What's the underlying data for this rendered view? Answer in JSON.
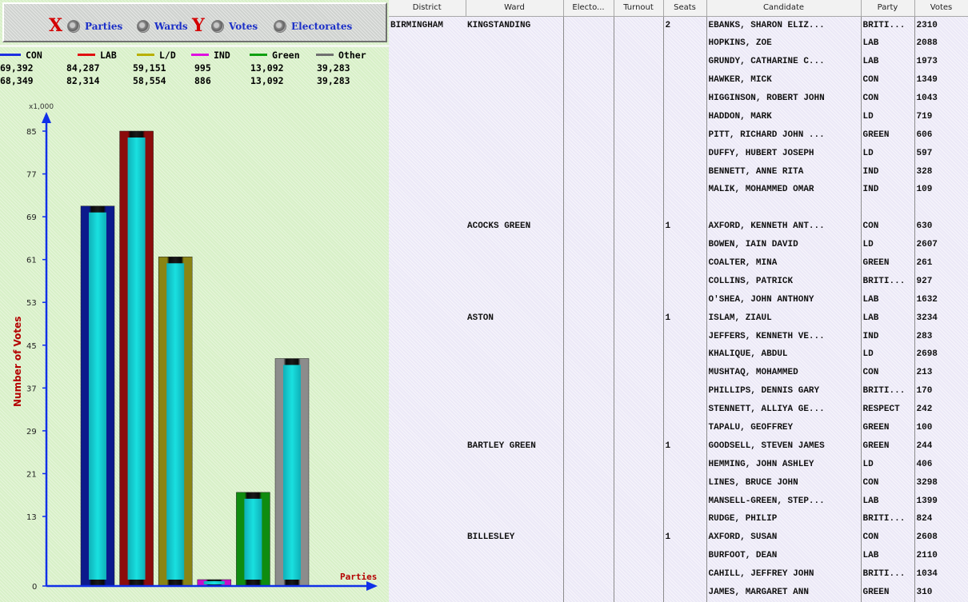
{
  "toolbar": {
    "x_axis_letter": "X",
    "y_axis_letter": "Y",
    "options": [
      {
        "label": "Parties"
      },
      {
        "label": "Wards"
      },
      {
        "label": "Votes"
      },
      {
        "label": "Electorates"
      }
    ]
  },
  "legend": {
    "series": [
      {
        "name": "CON",
        "color": "#1c2ee0",
        "votes": "69,392",
        "electorates": "68,349"
      },
      {
        "name": "LAB",
        "color": "#e01010",
        "votes": "84,287",
        "electorates": "82,314"
      },
      {
        "name": "L/D",
        "color": "#b8b000",
        "votes": "59,151",
        "electorates": "58,554"
      },
      {
        "name": "IND",
        "color": "#e010e0",
        "votes": "995",
        "electorates": "886"
      },
      {
        "name": "Green",
        "color": "#10a010",
        "votes": "13,092",
        "electorates": "13,092"
      },
      {
        "name": "Other",
        "color": "#707070",
        "votes": "39,283",
        "electorates": "39,283"
      }
    ]
  },
  "chart_data": {
    "type": "bar",
    "categories": [
      "CON",
      "LAB",
      "L/D",
      "IND",
      "Green",
      "Other"
    ],
    "values": [
      71,
      85,
      61.5,
      1.2,
      17.5,
      42.5
    ],
    "unit_label": "x1,000",
    "ylabel": "Number of Votes",
    "xlabel": "Parties",
    "ylim": [
      0,
      89
    ],
    "yticks": [
      0,
      13,
      21,
      29,
      37,
      45,
      53,
      61,
      69,
      77,
      85
    ],
    "bar_fill_colors": [
      "#0c1a8c",
      "#8c0c0c",
      "#8a8414",
      "#c810c8",
      "#0f8c0f",
      "#8c8c8c"
    ],
    "bar_core_color": "#19e0e0",
    "axis_color": "#1030e8",
    "legend_position": "top"
  },
  "table": {
    "columns": [
      "District",
      "Ward",
      "Electo...",
      "Turnout",
      "Seats",
      "Candidate",
      "Party",
      "Votes"
    ],
    "rows": [
      [
        "BIRMINGHAM",
        "KINGSTANDING",
        "",
        "",
        "2",
        "EBANKS, SHARON ELIZ...",
        "BRITI...",
        "2310"
      ],
      [
        "",
        "",
        "",
        "",
        "",
        "HOPKINS, ZOE",
        "LAB",
        "2088"
      ],
      [
        "",
        "",
        "",
        "",
        "",
        "GRUNDY, CATHARINE C...",
        "LAB",
        "1973"
      ],
      [
        "",
        "",
        "",
        "",
        "",
        "HAWKER, MICK",
        "CON",
        "1349"
      ],
      [
        "",
        "",
        "",
        "",
        "",
        "HIGGINSON, ROBERT JOHN",
        "CON",
        "1043"
      ],
      [
        "",
        "",
        "",
        "",
        "",
        "HADDON, MARK",
        "LD",
        "719"
      ],
      [
        "",
        "",
        "",
        "",
        "",
        "PITT, RICHARD JOHN ...",
        "GREEN",
        "606"
      ],
      [
        "",
        "",
        "",
        "",
        "",
        "DUFFY, HUBERT JOSEPH",
        "LD",
        "597"
      ],
      [
        "",
        "",
        "",
        "",
        "",
        "BENNETT, ANNE RITA",
        "IND",
        "328"
      ],
      [
        "",
        "",
        "",
        "",
        "",
        "MALIK, MOHAMMED OMAR",
        "IND",
        "109"
      ],
      [
        "",
        "",
        "",
        "",
        "",
        "",
        "",
        ""
      ],
      [
        "",
        "ACOCKS GREEN",
        "",
        "",
        "1",
        "AXFORD, KENNETH ANT...",
        "CON",
        "630"
      ],
      [
        "",
        "",
        "",
        "",
        "",
        "BOWEN, IAIN DAVID",
        "LD",
        "2607"
      ],
      [
        "",
        "",
        "",
        "",
        "",
        "COALTER, MINA",
        "GREEN",
        "261"
      ],
      [
        "",
        "",
        "",
        "",
        "",
        "COLLINS, PATRICK",
        "BRITI...",
        "927"
      ],
      [
        "",
        "",
        "",
        "",
        "",
        "O'SHEA, JOHN ANTHONY",
        "LAB",
        "1632"
      ],
      [
        "",
        "ASTON",
        "",
        "",
        "1",
        "ISLAM, ZIAUL",
        "LAB",
        "3234"
      ],
      [
        "",
        "",
        "",
        "",
        "",
        "JEFFERS, KENNETH VE...",
        "IND",
        "283"
      ],
      [
        "",
        "",
        "",
        "",
        "",
        "KHALIQUE, ABDUL",
        "LD",
        "2698"
      ],
      [
        "",
        "",
        "",
        "",
        "",
        "MUSHTAQ, MOHAMMED",
        "CON",
        "213"
      ],
      [
        "",
        "",
        "",
        "",
        "",
        "PHILLIPS, DENNIS GARY",
        "BRITI...",
        "170"
      ],
      [
        "",
        "",
        "",
        "",
        "",
        "STENNETT, ALLIYA GE...",
        "RESPECT",
        "242"
      ],
      [
        "",
        "",
        "",
        "",
        "",
        "TAPALU, GEOFFREY",
        "GREEN",
        "100"
      ],
      [
        "",
        "BARTLEY GREEN",
        "",
        "",
        "1",
        "GOODSELL, STEVEN JAMES",
        "GREEN",
        "244"
      ],
      [
        "",
        "",
        "",
        "",
        "",
        "HEMMING, JOHN ASHLEY",
        "LD",
        "406"
      ],
      [
        "",
        "",
        "",
        "",
        "",
        "LINES, BRUCE JOHN",
        "CON",
        "3298"
      ],
      [
        "",
        "",
        "",
        "",
        "",
        "MANSELL-GREEN, STEP...",
        "LAB",
        "1399"
      ],
      [
        "",
        "",
        "",
        "",
        "",
        "RUDGE, PHILIP",
        "BRITI...",
        "824"
      ],
      [
        "",
        "BILLESLEY",
        "",
        "",
        "1",
        "AXFORD, SUSAN",
        "CON",
        "2608"
      ],
      [
        "",
        "",
        "",
        "",
        "",
        "BURFOOT, DEAN",
        "LAB",
        "2110"
      ],
      [
        "",
        "",
        "",
        "",
        "",
        "CAHILL, JEFFREY JOHN",
        "BRITI...",
        "1034"
      ],
      [
        "",
        "",
        "",
        "",
        "",
        "JAMES, MARGARET ANN",
        "GREEN",
        "310"
      ]
    ]
  }
}
